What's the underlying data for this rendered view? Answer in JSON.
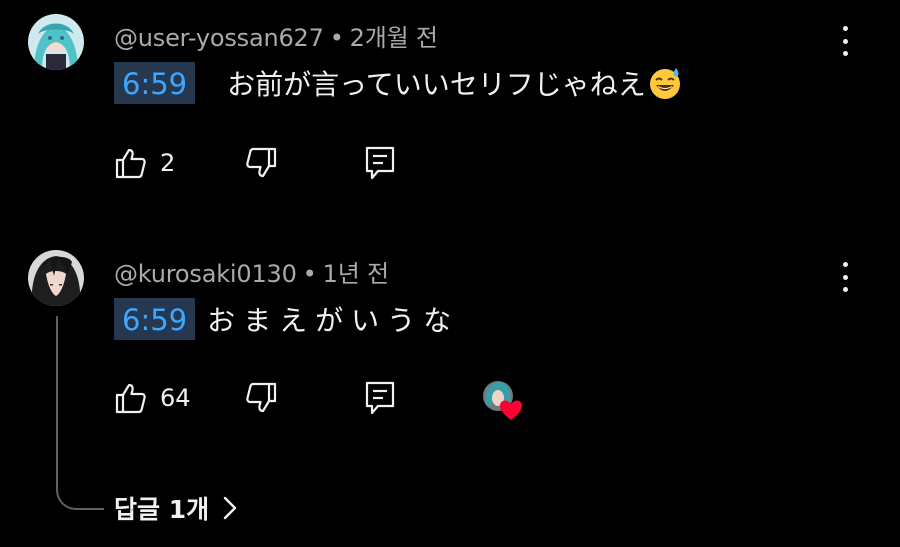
{
  "comments": [
    {
      "author": "@user-yossan627",
      "time": "2개월 전",
      "timestamp_link": "6:59",
      "text": "お前が言っていいセリフじゃねえ",
      "emoji": "sweat-smile-emoji",
      "likes": "2",
      "avatar": "anime-avatar-teal-hair"
    },
    {
      "author": "@kurosaki0130",
      "time": "1년 전",
      "timestamp_link": "6:59",
      "text": "おまえがいうな",
      "likes": "64",
      "avatar": "anime-avatar-dark-hair",
      "creator_heart": true
    }
  ],
  "replies_toggle": {
    "label": "답글 1개",
    "icon": "chevron-right-icon"
  },
  "meta_separator": "•",
  "icons": {
    "like": "thumbs-up-icon",
    "dislike": "thumbs-down-icon",
    "reply": "reply-icon",
    "more": "more-vert-icon",
    "heart": "heart-icon"
  },
  "colors": {
    "background": "#000000",
    "text": "#f1f1f1",
    "meta": "#aaaaaa",
    "timestamp_text": "#3ea6ff",
    "timestamp_bg": "#263850",
    "heart": "#ff0033",
    "thread_line": "#606060"
  }
}
